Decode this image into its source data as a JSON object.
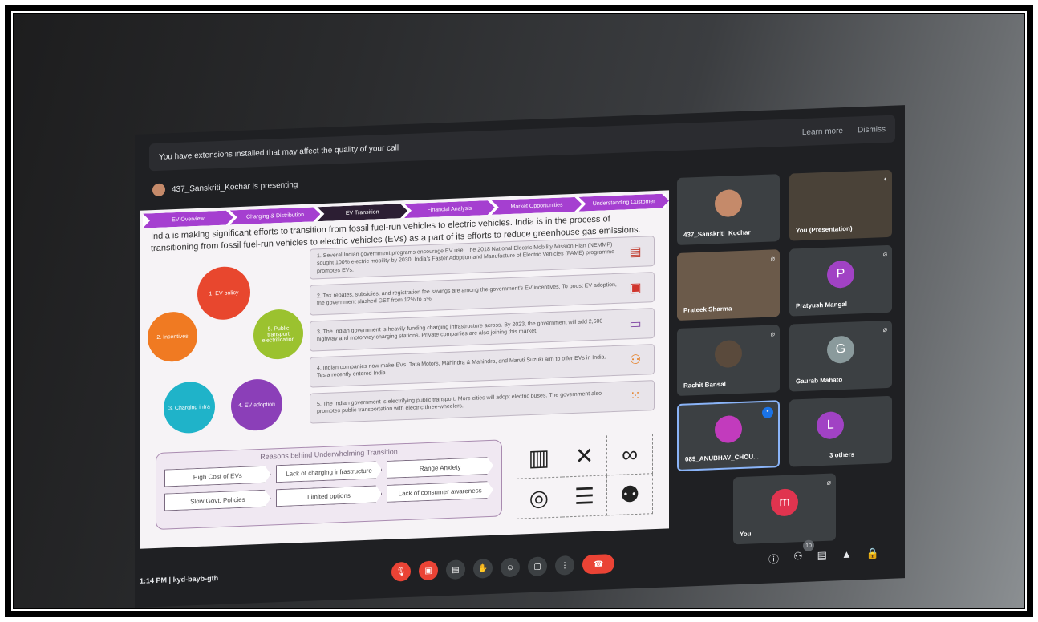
{
  "extension_bar": {
    "message": "You have extensions installed that may affect the quality of your call",
    "learn_more": "Learn more",
    "dismiss": "Dismiss"
  },
  "presenting": {
    "text": "437_Sanskriti_Kochar is presenting"
  },
  "slide": {
    "tabs": [
      "EV Overview",
      "Charging & Distribution",
      "EV Transition",
      "Financial Analysis",
      "Market Opportunities",
      "Understanding Customer"
    ],
    "headline": "India is making significant efforts to transition from fossil fuel-run vehicles to electric vehicles. India is in the process of transitioning from fossil fuel-run vehicles to electric vehicles (EVs) as a part of its efforts to reduce greenhouse gas emissions.",
    "cycle": [
      "1. EV policy",
      "5. Public transport electrification",
      "4. EV adoption",
      "3. Charging infra",
      "2. Incentives"
    ],
    "points": [
      "1. Several Indian government programs encourage EV use. The 2018 National Electric Mobility Mission Plan (NEMMP) sought 100% electric mobility by 2030. India's Faster Adoption and Manufacture of Electric Vehicles (FAME) programme promotes EVs.",
      "2. Tax rebates, subsidies, and registration fee savings are among the government's EV incentives. To boost EV adoption, the government slashed GST from 12% to 5%.",
      "3. The Indian government is heavily funding charging infrastructure across. By 2023, the government will add 2,500 highway and motorway charging stations. Private companies are also joining this market.",
      "4. Indian companies now make EVs. Tata Motors, Mahindra & Mahindra, and Maruti Suzuki aim to offer EVs in India. Tesla recently entered India.",
      "5. The Indian government is electrifying public transport. More cities will adopt electric buses. The government also promotes public transportation with electric three-wheelers."
    ],
    "reasons_title": "Reasons behind Underwhelming Transition",
    "reasons": [
      "High Cost of EVs",
      "Lack of charging infrastructure",
      "Range Anxiety",
      "Slow Govt. Policies",
      "Limited options",
      "Lack of consumer awareness"
    ]
  },
  "tiles": [
    {
      "name": "437_Sanskriti_Kochar",
      "initial": ""
    },
    {
      "name": "You (Presentation)",
      "initial": ""
    },
    {
      "name": "Prateek Sharma",
      "initial": ""
    },
    {
      "name": "Pratyush Mangal",
      "initial": "P"
    },
    {
      "name": "Rachit Bansal",
      "initial": ""
    },
    {
      "name": "Gaurab Mahato",
      "initial": "G"
    },
    {
      "name": "089_ANUBHAV_CHOU...",
      "initial": ""
    },
    {
      "name": "3 others",
      "initial": "L"
    },
    {
      "name": "You",
      "initial": "m"
    }
  ],
  "bottom": {
    "time": "1:14 PM",
    "separator": "|",
    "code": "kyd-bayb-gth",
    "participant_count": "10"
  },
  "colors": {
    "accent": "#a53fd0",
    "end_call": "#ea4335",
    "tile_bg": "#3c4043",
    "active_border": "#8ab4f8"
  }
}
